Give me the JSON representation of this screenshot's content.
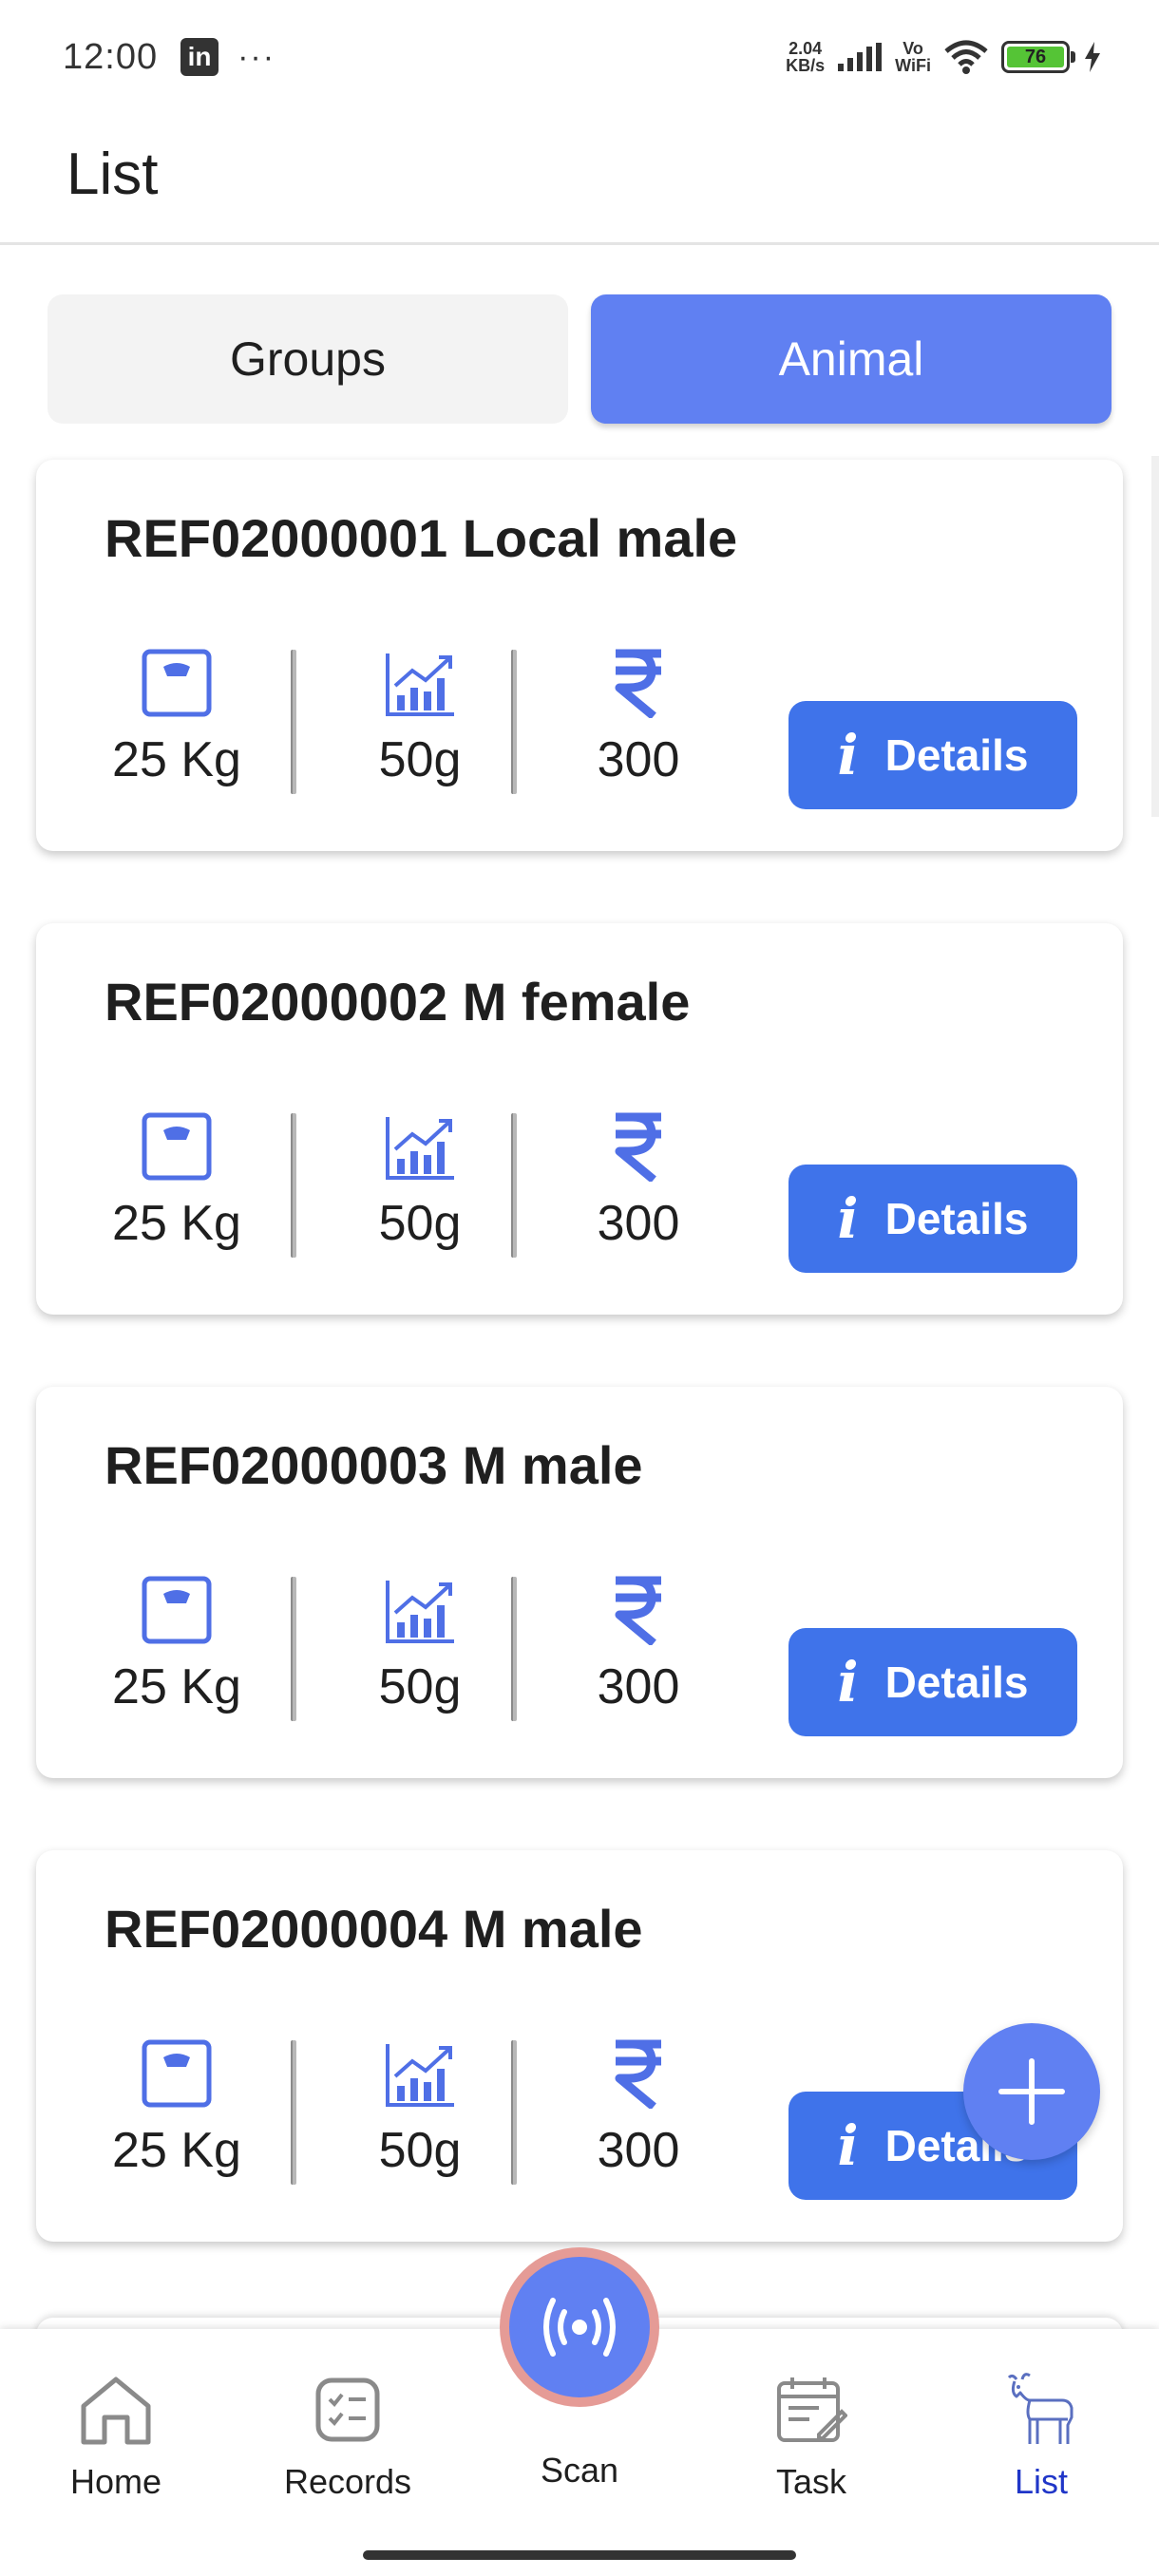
{
  "status_bar": {
    "time": "12:00",
    "app_icon": "in",
    "more": "···",
    "net_speed_value": "2.04",
    "net_speed_unit": "KB/s",
    "volte_top": "Vo",
    "volte_bottom": "WiFi",
    "battery_level": "76"
  },
  "header": {
    "title": "List"
  },
  "tabs": [
    {
      "label": "Groups",
      "active": false
    },
    {
      "label": "Animal",
      "active": true
    }
  ],
  "cards": [
    {
      "title": "REF02000001 Local male",
      "weight": "25 Kg",
      "growth": "50g",
      "price": "300",
      "details_label": "Details"
    },
    {
      "title": "REF02000002 M female",
      "weight": "25 Kg",
      "growth": "50g",
      "price": "300",
      "details_label": "Details"
    },
    {
      "title": "REF02000003 M male",
      "weight": "25 Kg",
      "growth": "50g",
      "price": "300",
      "details_label": "Details"
    },
    {
      "title": "REF02000004 M male",
      "weight": "25 Kg",
      "growth": "50g",
      "price": "300",
      "details_label": "Details"
    }
  ],
  "bottom_nav": [
    {
      "label": "Home",
      "icon": "home-icon"
    },
    {
      "label": "Records",
      "icon": "records-icon"
    },
    {
      "label": "Scan",
      "icon": "scan-icon"
    },
    {
      "label": "Task",
      "icon": "task-icon"
    },
    {
      "label": "List",
      "icon": "goat-icon",
      "active": true
    }
  ],
  "colors": {
    "accent": "#6080f2",
    "button": "#3f73ea",
    "active_nav": "#2036c8",
    "scan_ring": "#e59b96"
  }
}
